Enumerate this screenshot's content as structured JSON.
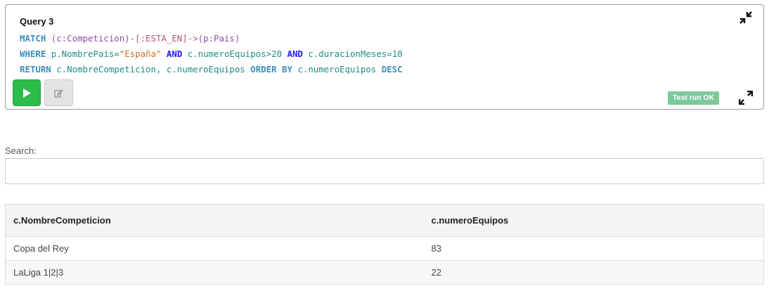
{
  "query": {
    "title": "Query 3",
    "lines": [
      [
        {
          "t": "MATCH ",
          "c": "kw"
        },
        {
          "t": "(c:Competicion)",
          "c": "pat"
        },
        {
          "t": "-[:ESTA_EN]->",
          "c": "rel"
        },
        {
          "t": "(p:Pais)",
          "c": "pat"
        }
      ],
      [
        {
          "t": "WHERE ",
          "c": "kw"
        },
        {
          "t": "p.NombrePais=",
          "c": "prop"
        },
        {
          "t": "\"España\"",
          "c": "str"
        },
        {
          "t": " AND ",
          "c": "kw2"
        },
        {
          "t": "c.numeroEquipos>20",
          "c": "prop"
        },
        {
          "t": " AND ",
          "c": "kw2"
        },
        {
          "t": "c.duracionMeses=10",
          "c": "prop"
        }
      ],
      [
        {
          "t": "RETURN ",
          "c": "kw"
        },
        {
          "t": "c.NombreCompeticion, c.numeroEquipos ",
          "c": "prop"
        },
        {
          "t": "ORDER BY ",
          "c": "kw"
        },
        {
          "t": "c.numeroEquipos ",
          "c": "prop"
        },
        {
          "t": "DESC",
          "c": "kw"
        }
      ]
    ],
    "run_icon": "play-icon",
    "edit_icon": "pencil-icon",
    "status": "Test run OK",
    "status_color": "#7ec99a",
    "run_color": "#2dbb4a",
    "collapse_icon": "collapse-arrows-icon",
    "expand_icon": "expand-arrows-icon"
  },
  "search": {
    "label": "Search:",
    "value": "",
    "placeholder": ""
  },
  "table": {
    "headers": [
      "c.NombreCompeticion",
      "c.numeroEquipos"
    ],
    "rows": [
      [
        "Copa del Rey",
        "83"
      ],
      [
        "LaLiga 1|2|3",
        "22"
      ]
    ]
  }
}
